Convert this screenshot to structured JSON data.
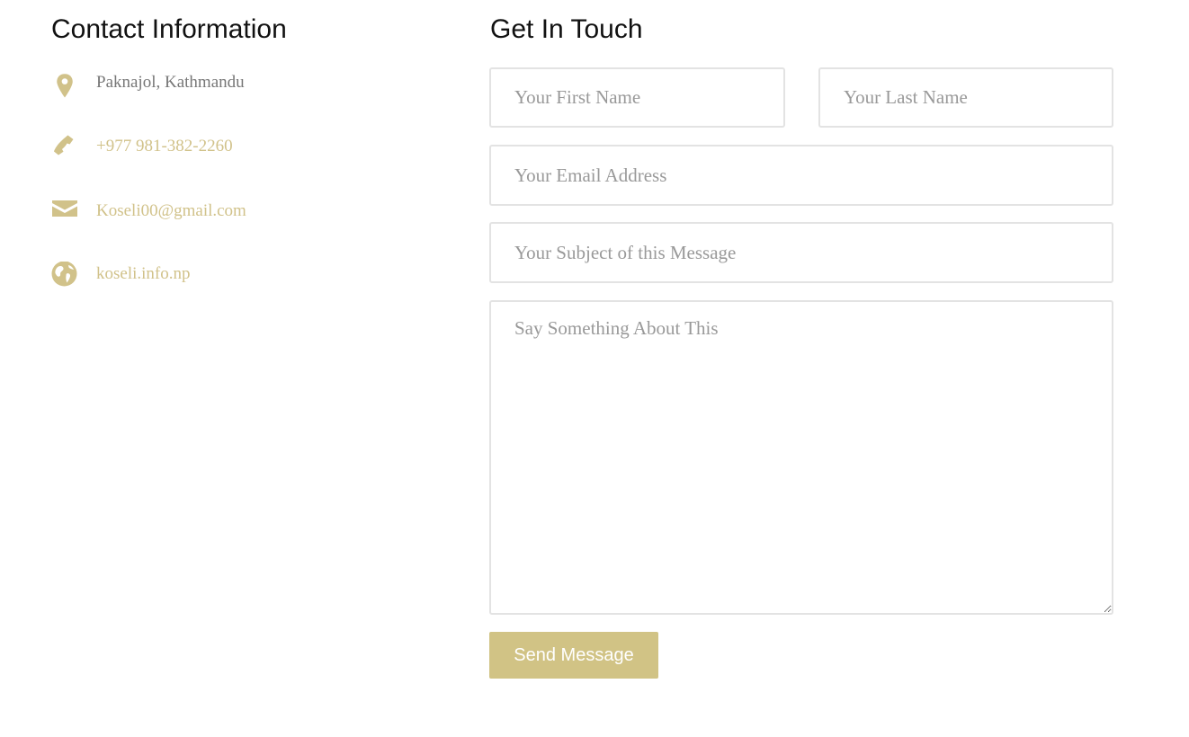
{
  "colors": {
    "accent": "#d1c28a",
    "button_bg": "#d1c385",
    "border": "#e3e3e3",
    "muted_text": "#777777",
    "placeholder": "#999999"
  },
  "contact": {
    "heading": "Contact Information",
    "items": [
      {
        "icon": "map-pin-icon",
        "text": "Paknajol, Kathmandu"
      },
      {
        "icon": "phone-icon",
        "text": "+977 981-382-2260"
      },
      {
        "icon": "envelope-icon",
        "text": "Koseli00@gmail.com"
      },
      {
        "icon": "globe-icon",
        "text": "koseli.info.np"
      }
    ]
  },
  "form": {
    "heading": "Get In Touch",
    "first_name_placeholder": "Your First Name",
    "last_name_placeholder": "Your Last Name",
    "email_placeholder": "Your Email Address",
    "subject_placeholder": "Your Subject of this Message",
    "message_placeholder": "Say Something About This",
    "submit_label": "Send Message"
  }
}
